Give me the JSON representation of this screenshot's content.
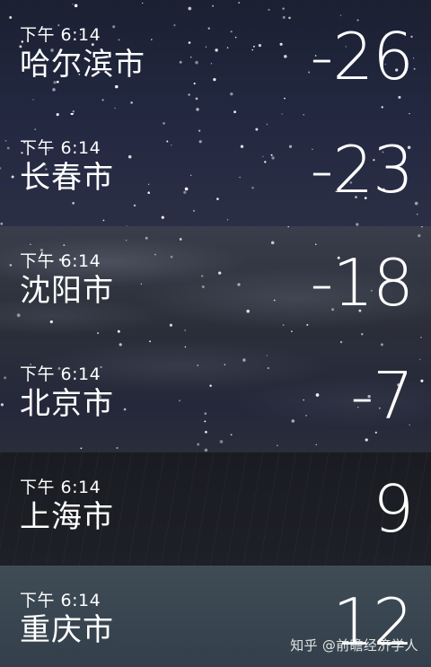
{
  "cities": [
    {
      "time": "下午 6:14",
      "name": "哈尔滨市",
      "temp": "-26"
    },
    {
      "time": "下午 6:14",
      "name": "长春市",
      "temp": "-23"
    },
    {
      "time": "下午 6:14",
      "name": "沈阳市",
      "temp": "-18"
    },
    {
      "time": "下午 6:14",
      "name": "北京市",
      "temp": "-7"
    },
    {
      "time": "下午 6:14",
      "name": "上海市",
      "temp": "9"
    },
    {
      "time": "下午 6:14",
      "name": "重庆市",
      "temp": "12"
    }
  ],
  "watermark": "知乎 @前瞻经济学人",
  "colors": {
    "night_sky": "#1b2032",
    "cloudy_night": "#30343f",
    "rainy_night": "#1a1c22",
    "overcast": "#3f4c56",
    "text": "#ffffff"
  }
}
